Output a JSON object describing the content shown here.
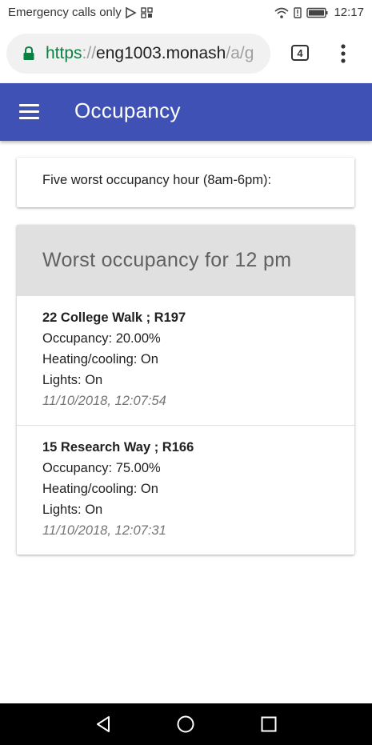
{
  "status_bar": {
    "carrier": "Emergency calls only",
    "time": "12:17"
  },
  "browser": {
    "url_scheme": "https",
    "url_sep": "://",
    "url_host": "eng1003.monash",
    "url_path": "/a/g",
    "tab_count": "4"
  },
  "app_bar": {
    "title": "Occupancy"
  },
  "intro": {
    "text": "Five worst occupancy hour (8am-6pm):"
  },
  "worst_list": {
    "header": "Worst occupancy for 12 pm",
    "entries": [
      {
        "title": "22 College Walk ; R197",
        "occupancy": "Occupancy: 20.00%",
        "hvac": "Heating/cooling: On",
        "lights": "Lights: On",
        "timestamp": "11/10/2018, 12:07:54"
      },
      {
        "title": "15 Research Way ; R166",
        "occupancy": "Occupancy: 75.00%",
        "hvac": "Heating/cooling: On",
        "lights": "Lights: On",
        "timestamp": "11/10/2018, 12:07:31"
      }
    ]
  },
  "colors": {
    "app_bar": "#3f51b5",
    "card_header": "#e0e0e0",
    "secure_green": "#0b8043"
  },
  "icons": {
    "status_left": [
      "play-store-icon",
      "qr-icon"
    ],
    "status_right": [
      "wifi-icon",
      "alert-icon",
      "battery-icon"
    ],
    "browser": [
      "lock-icon",
      "tab-switcher-icon",
      "more-vert-icon"
    ],
    "app_bar": [
      "menu-icon"
    ],
    "nav": [
      "back-icon",
      "home-icon",
      "recents-icon"
    ]
  }
}
